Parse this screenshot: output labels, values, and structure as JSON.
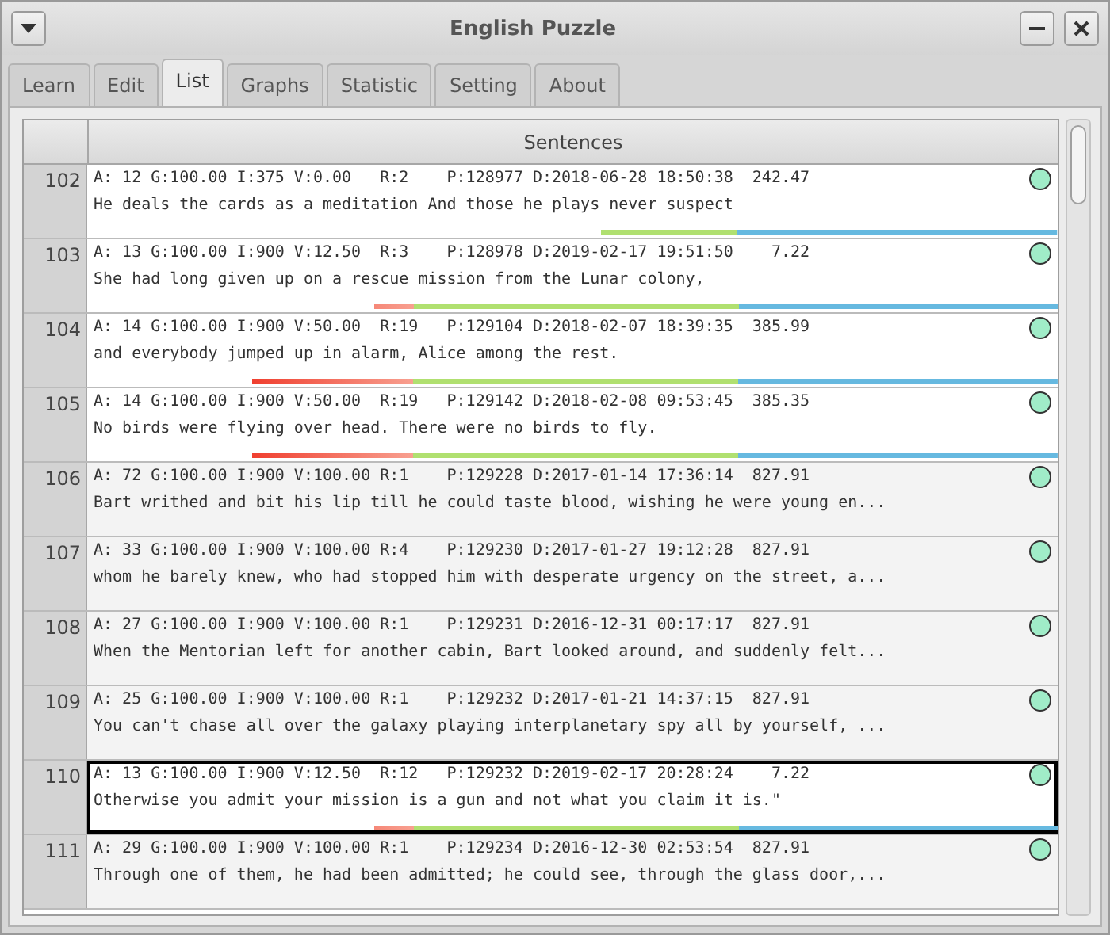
{
  "window": {
    "title": "English Puzzle"
  },
  "tabs": [
    {
      "label": "Learn",
      "selected": false
    },
    {
      "label": "Edit",
      "selected": false
    },
    {
      "label": "List",
      "selected": true
    },
    {
      "label": "Graphs",
      "selected": false
    },
    {
      "label": "Statistic",
      "selected": false
    },
    {
      "label": "Setting",
      "selected": false
    },
    {
      "label": "About",
      "selected": false
    }
  ],
  "table": {
    "columns": [
      "Sentences"
    ],
    "rows": [
      {
        "number": "102",
        "stats": "A: 12 G:100.00 I:375 V:0.00   R:2    P:128977 D:2018-06-28 18:50:38  242.47",
        "sentence": "He deals the cards as a meditation And those he plays never suspect",
        "active": true,
        "selected": false,
        "level": 0.47
      },
      {
        "number": "103",
        "stats": "A: 13 G:100.00 I:900 V:12.50  R:3    P:128978 D:2019-02-17 19:51:50    7.22",
        "sentence": "She had long given up on a rescue mission from the Lunar colony,",
        "active": true,
        "selected": false,
        "level": 0.705
      },
      {
        "number": "104",
        "stats": "A: 14 G:100.00 I:900 V:50.00  R:19   P:129104 D:2018-02-07 18:39:35  385.99",
        "sentence": "and everybody jumped up in alarm, Alice among the rest.",
        "active": true,
        "selected": false,
        "level": 0.83
      },
      {
        "number": "105",
        "stats": "A: 14 G:100.00 I:900 V:50.00  R:19   P:129142 D:2018-02-08 09:53:45  385.35",
        "sentence": "No birds were flying over head. There were no birds to fly.",
        "active": true,
        "selected": false,
        "level": 0.83
      },
      {
        "number": "106",
        "stats": "A: 72 G:100.00 I:900 V:100.00 R:1    P:129228 D:2017-01-14 17:36:14  827.91",
        "sentence": "Bart writhed and bit his lip till he could taste blood, wishing he were young en...",
        "active": false,
        "selected": false
      },
      {
        "number": "107",
        "stats": "A: 33 G:100.00 I:900 V:100.00 R:4    P:129230 D:2017-01-27 19:12:28  827.91",
        "sentence": "whom he barely knew, who had stopped him with desperate urgency on the street, a...",
        "active": false,
        "selected": false
      },
      {
        "number": "108",
        "stats": "A: 27 G:100.00 I:900 V:100.00 R:1    P:129231 D:2016-12-31 00:17:17  827.91",
        "sentence": "When the Mentorian left for another cabin, Bart looked around, and suddenly felt...",
        "active": false,
        "selected": false
      },
      {
        "number": "109",
        "stats": "A: 25 G:100.00 I:900 V:100.00 R:1    P:129232 D:2017-01-21 14:37:15  827.91",
        "sentence": "You can't chase all over the galaxy playing interplanetary spy all by yourself, ...",
        "active": false,
        "selected": false
      },
      {
        "number": "110",
        "stats": "A: 13 G:100.00 I:900 V:12.50  R:12   P:129232 D:2019-02-17 20:28:24    7.22",
        "sentence": "Otherwise you admit your mission is a gun and not what you claim it is.\"",
        "active": true,
        "selected": true,
        "level": 0.705
      },
      {
        "number": "111",
        "stats": "A: 29 G:100.00 I:900 V:100.00 R:1    P:129234 D:2016-12-30 02:53:54  827.91",
        "sentence": "Through one of them, he had been admitted; he could see, through the glass door,...",
        "active": false,
        "selected": false
      }
    ]
  }
}
